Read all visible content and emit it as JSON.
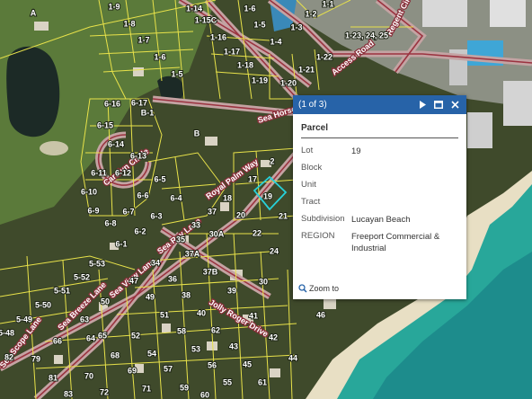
{
  "map": {
    "area_labels": [
      "A",
      "B"
    ],
    "lot_labels": [
      "1-9",
      "1-8",
      "1-7",
      "1-6",
      "1-5",
      "1-14",
      "1-15C",
      "1-16",
      "1-17",
      "1-18",
      "1-19",
      "1-20",
      "1-21",
      "1-22",
      "1-6",
      "1-5",
      "1-4",
      "1-3",
      "1-2",
      "1-1",
      "1-23, 24, 25",
      "6-16",
      "6-17",
      "B-1",
      "6-15",
      "6-14",
      "6-13",
      "6-11",
      "6-12",
      "6-5",
      "6-10",
      "6-9",
      "6-6",
      "6-7",
      "6-8",
      "6-3",
      "6-4",
      "6-2",
      "6-1",
      "17",
      "18",
      "19",
      "2",
      "37",
      "20",
      "21",
      "33",
      "30A",
      "22",
      "35",
      "37A",
      "24",
      "34",
      "37B",
      "36",
      "38",
      "39",
      "30",
      "5-53",
      "5-52",
      "5-51",
      "5-50",
      "5-49",
      "5-48",
      "82",
      "50",
      "49",
      "47",
      "51",
      "40",
      "41",
      "63",
      "64",
      "66",
      "79",
      "81",
      "83",
      "72",
      "70",
      "71",
      "69",
      "68",
      "65",
      "52",
      "54",
      "56",
      "57",
      "58",
      "53",
      "55",
      "59",
      "60",
      "61",
      "62",
      "42",
      "43",
      "44",
      "45",
      "46",
      "28"
    ],
    "road_labels": [
      "Access Road",
      "Sea Horse",
      "Royal Palm Way",
      "Carolyn Circle",
      "Regent Circle",
      "Sea Ray Lane",
      "Sea View Lane",
      "Sea Breeze Lane",
      "Sea Scope Lane",
      "Jolly Roger Drive"
    ]
  },
  "popup": {
    "count": "(1 of 3)",
    "title": "Parcel",
    "fields": [
      {
        "key": "Lot",
        "value": "19"
      },
      {
        "key": "Block",
        "value": ""
      },
      {
        "key": "Unit",
        "value": ""
      },
      {
        "key": "Tract",
        "value": ""
      },
      {
        "key": "Subdivision",
        "value": "Lucayan Beach"
      },
      {
        "key": "REGION",
        "value": "Freeport Commercial & Industrial"
      }
    ],
    "zoom_label": "Zoom to",
    "header_color": "#2763a8",
    "highlight_color": "#27d1d9"
  }
}
